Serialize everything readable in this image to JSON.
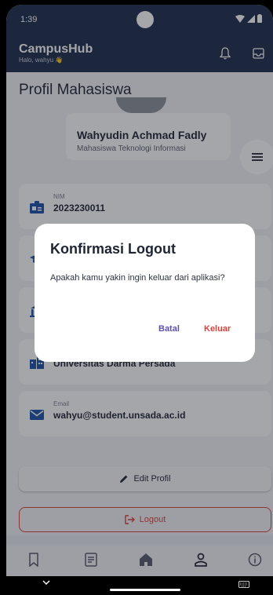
{
  "status": {
    "time": "1:39"
  },
  "app": {
    "title": "CampusHub",
    "subtitle": "Halo, wahyu 👋"
  },
  "page": {
    "title": "Profil Mahasiswa"
  },
  "profile": {
    "name": "Wahyudin Achmad Fadly",
    "role": "Mahasiswa Teknologi Informasi"
  },
  "fields": [
    {
      "label": "NIM",
      "value": "2023230011",
      "icon": "id-card-icon"
    },
    {
      "label": "",
      "value": "",
      "icon": "graduation-cap-icon"
    },
    {
      "label": "",
      "value": "",
      "icon": "building-icon"
    },
    {
      "label": "",
      "value": "Universitas Darma Persada",
      "icon": "city-icon"
    },
    {
      "label": "Email",
      "value": "wahyu@student.unsada.ac.id",
      "icon": "mail-icon"
    }
  ],
  "actions": {
    "edit": "Edit Profil",
    "logout": "Logout"
  },
  "dialog": {
    "title": "Konfirmasi Logout",
    "message": "Apakah kamu yakin ingin keluar dari aplikasi?",
    "cancel": "Batal",
    "confirm": "Keluar"
  },
  "bottom_nav": [
    "bookmark-icon",
    "document-icon",
    "home-icon",
    "person-icon",
    "info-icon"
  ],
  "colors": {
    "primary": "#1b2a4a",
    "danger": "#d9413a",
    "accent": "#5b4fb0"
  }
}
